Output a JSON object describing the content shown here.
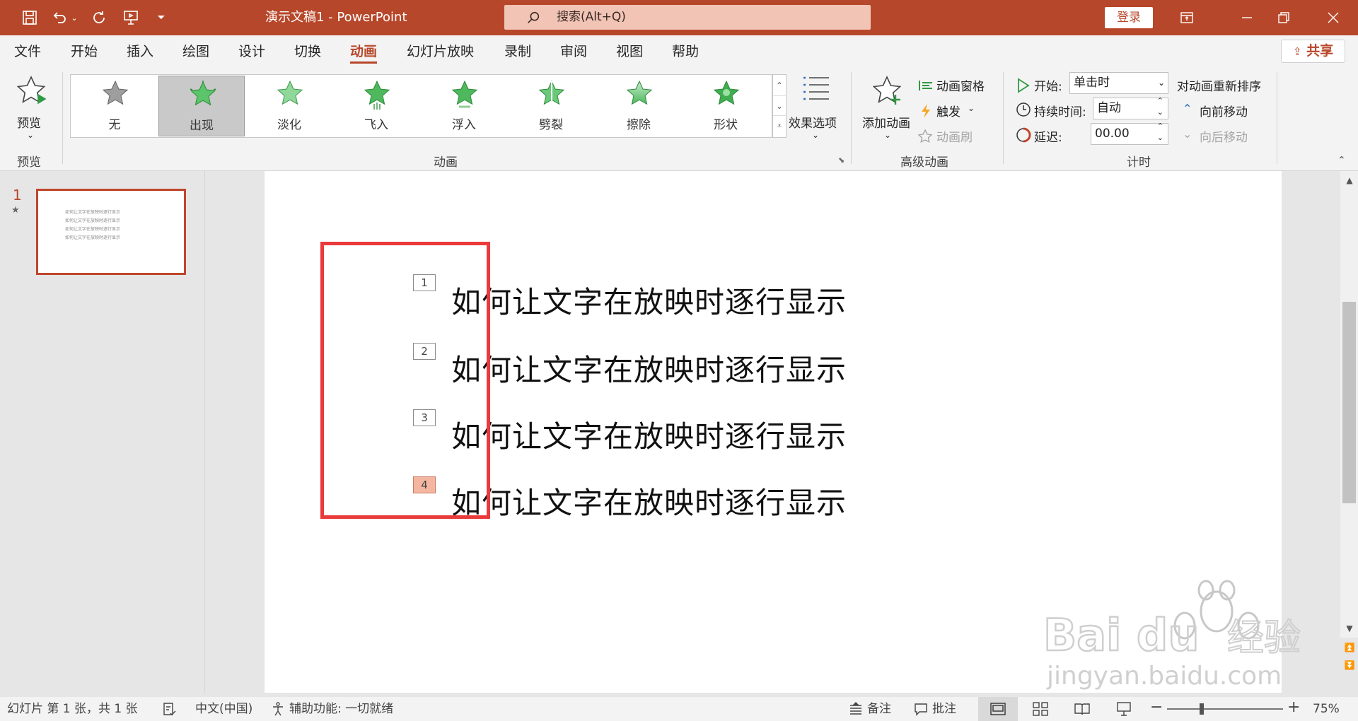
{
  "titlebar": {
    "title": "演示文稿1  -  PowerPoint",
    "search_placeholder": "搜索(Alt+Q)",
    "login": "登录"
  },
  "tabs": [
    {
      "label": "文件"
    },
    {
      "label": "开始"
    },
    {
      "label": "插入"
    },
    {
      "label": "绘图"
    },
    {
      "label": "设计"
    },
    {
      "label": "切换"
    },
    {
      "label": "动画",
      "active": true
    },
    {
      "label": "幻灯片放映"
    },
    {
      "label": "录制"
    },
    {
      "label": "审阅"
    },
    {
      "label": "视图"
    },
    {
      "label": "帮助"
    }
  ],
  "share": "共享",
  "ribbon": {
    "preview": {
      "button": "预览",
      "group": "预览"
    },
    "animations": {
      "group": "动画",
      "items": [
        {
          "label": "无",
          "icon": "star-none-icon"
        },
        {
          "label": "出现",
          "icon": "star-appear-icon",
          "selected": true
        },
        {
          "label": "淡化",
          "icon": "star-fade-icon"
        },
        {
          "label": "飞入",
          "icon": "star-fly-in-icon"
        },
        {
          "label": "浮入",
          "icon": "star-float-in-icon"
        },
        {
          "label": "劈裂",
          "icon": "star-split-icon"
        },
        {
          "label": "擦除",
          "icon": "star-wipe-icon"
        },
        {
          "label": "形状",
          "icon": "star-shape-icon"
        }
      ],
      "effect_options": "效果选项"
    },
    "advanced": {
      "group": "高级动画",
      "add_animation": "添加动画",
      "animation_pane": "动画窗格",
      "trigger": "触发",
      "animation_painter": "动画刷"
    },
    "timing": {
      "group": "计时",
      "start_label": "开始:",
      "start_value": "单击时",
      "duration_label": "持续时间:",
      "duration_value": "自动",
      "delay_label": "延迟:",
      "delay_value": "00.00",
      "reorder_title": "对动画重新排序",
      "move_earlier": "向前移动",
      "move_later": "向后移动"
    }
  },
  "thumbnail": {
    "number": "1",
    "star": "★",
    "lines": [
      "如何让文字在放映时逐行显示",
      "如何让文字在放映时逐行显示",
      "如何让文字在放映时逐行显示",
      "如何让文字在放映时逐行显示"
    ]
  },
  "slide": {
    "lines": [
      {
        "tag": "1",
        "text": "如何让文字在放映时逐行显示"
      },
      {
        "tag": "2",
        "text": "如何让文字在放映时逐行显示"
      },
      {
        "tag": "3",
        "text": "如何让文字在放映时逐行显示"
      },
      {
        "tag": "4",
        "text": "如何让文字在放映时逐行显示",
        "highlight": true
      }
    ]
  },
  "statusbar": {
    "slide_info": "幻灯片 第 1 张，共 1 张",
    "language": "中文(中国)",
    "accessibility": "辅助功能: 一切就绪",
    "notes": "备注",
    "comments": "批注",
    "zoom": "75%",
    "zoom_fraction": 0.3
  },
  "colors": {
    "accent": "#b7472a",
    "highlight_tag": "#f4b6a0",
    "annotation_box": "#ea3a3a"
  }
}
